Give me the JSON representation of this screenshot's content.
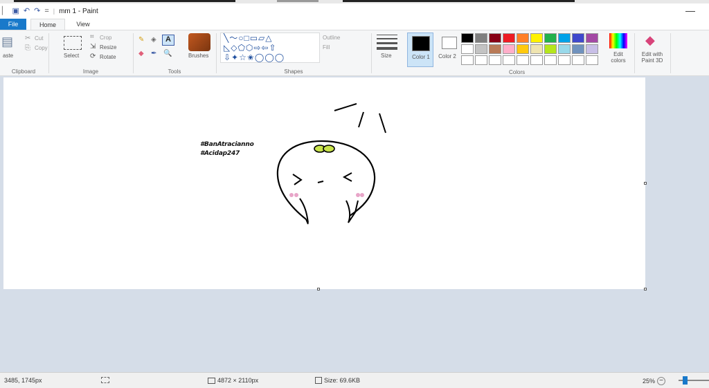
{
  "window": {
    "title": "mm 1 - Paint",
    "minimize_glyph": "—"
  },
  "quick_access": [
    {
      "icon": "save-icon",
      "glyph": "💾"
    },
    {
      "icon": "undo-icon",
      "glyph": "↶"
    },
    {
      "icon": "redo-icon",
      "glyph": "↷"
    },
    {
      "icon": "customize-icon",
      "glyph": "="
    }
  ],
  "tabs": {
    "file": "File",
    "home": "Home",
    "view": "View"
  },
  "ribbon": {
    "clipboard": {
      "paste": "aste",
      "cut": "Cut",
      "copy": "Copy",
      "label": "Clipboard"
    },
    "image": {
      "select": "Select",
      "crop": "Crop",
      "resize": "Resize",
      "rotate": "Rotate",
      "label": "Image"
    },
    "tools": {
      "brushes": "Brushes",
      "label": "Tools"
    },
    "shapes": {
      "outline": "Outline",
      "fill": "Fill",
      "label": "Shapes"
    },
    "size": {
      "label": "Size"
    },
    "colors": {
      "color1_label": "Color 1",
      "color2_label": "Color 2",
      "edit_colors": "Edit colors",
      "paint3d": "Edit with Paint 3D",
      "label": "Colors",
      "palette": [
        "#000000",
        "#7f7f7f",
        "#880015",
        "#ed1c24",
        "#ff7f27",
        "#fff200",
        "#22b14c",
        "#00a2e8",
        "#3f48cc",
        "#a349a4",
        "#ffffff",
        "#c3c3c3",
        "#b97a57",
        "#ffaec9",
        "#ffc90e",
        "#efe4b0",
        "#b5e61d",
        "#99d9ea",
        "#7092be",
        "#c8bfe7",
        "#ffffff",
        "#ffffff",
        "#ffffff",
        "#ffffff",
        "#ffffff",
        "#ffffff",
        "#ffffff",
        "#ffffff",
        "#ffffff",
        "#ffffff"
      ]
    }
  },
  "canvas": {
    "text_line1": "#BanAtracianno",
    "text_line2": "#Acidap247"
  },
  "status": {
    "cursor_pos": "3485, 1745px",
    "dimensions": "4872 × 2110px",
    "size": "Size: 69.6KB",
    "zoom": "25%"
  }
}
